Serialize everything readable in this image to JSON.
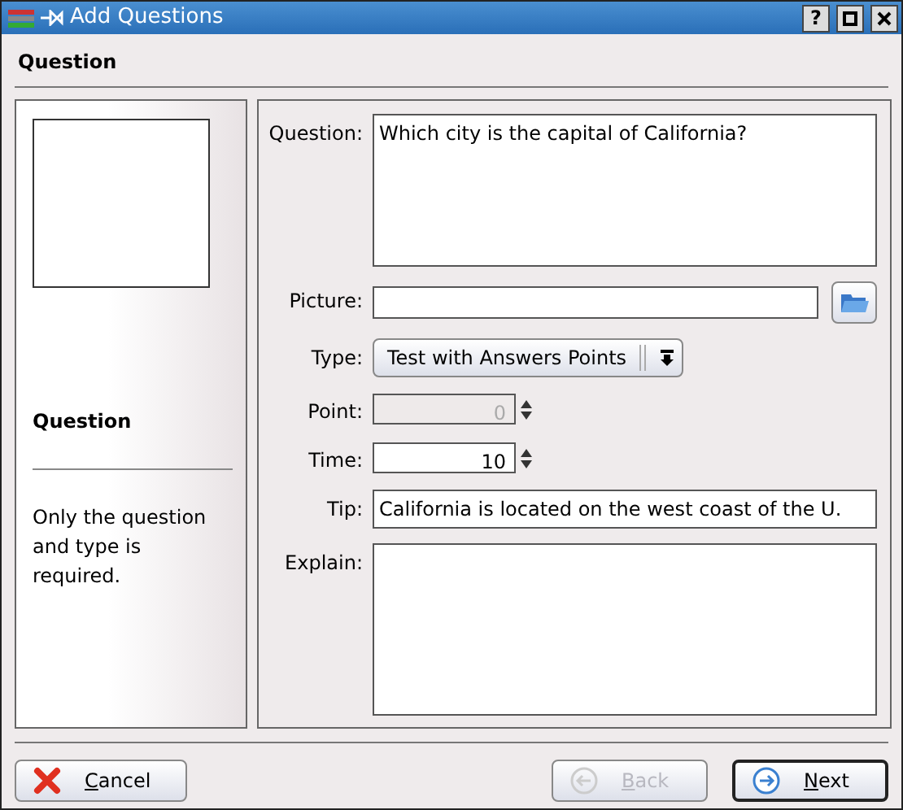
{
  "window": {
    "title": "Add Questions",
    "help_button": "?"
  },
  "page_title": "Question",
  "side_panel": {
    "heading": "Question",
    "note": "Only the question and type is required."
  },
  "form": {
    "fields": [
      {
        "kind": "textarea",
        "label": "Question:",
        "value": "Which city is the capital of California?"
      },
      {
        "kind": "file",
        "label": "Picture:"
      },
      {
        "kind": "select",
        "label": "Type:",
        "value": "Test with Answers Points"
      },
      {
        "kind": "spin",
        "label": "Point:",
        "value": "0",
        "disabled": true
      },
      {
        "kind": "spin",
        "label": "Time:",
        "value": "10",
        "disabled": false
      },
      {
        "kind": "text",
        "label": "Tip:",
        "value": "California is located on the west coast of the U."
      },
      {
        "kind": "textarea",
        "label": "Explain:"
      }
    ]
  },
  "buttons": [
    {
      "kind": "cancel",
      "label": "Cancel",
      "disabled": false,
      "default": false
    },
    {
      "kind": "back",
      "label": "Back",
      "disabled": true,
      "default": false
    },
    {
      "kind": "next",
      "label": "Next",
      "disabled": false,
      "default": true
    }
  ]
}
